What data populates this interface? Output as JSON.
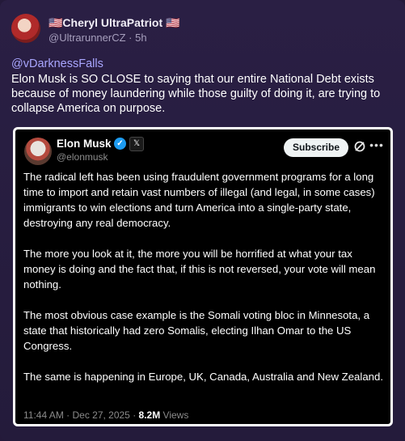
{
  "author": {
    "display_name": "🇺🇸Cheryl UltraPatriot 🇺🇸",
    "handle": "@UltrarunnerCZ",
    "separator": " · ",
    "time_ago": "5h"
  },
  "post": {
    "mention": "@vDarknessFalls",
    "text": "Elon Musk is SO CLOSE to saying that our entire National Debt exists because of money laundering while those guilty of doing it, are trying to collapse America on purpose."
  },
  "embed": {
    "author_name": "Elon Musk",
    "verified_icon": "verified-check-icon",
    "x_icon": "x-logo-icon",
    "handle": "@elonmusk",
    "subscribe_label": "Subscribe",
    "grok_icon": "grok-icon",
    "more_icon": "more-dots-icon",
    "paragraphs": [
      "The radical left has been using fraudulent government programs for a long time to import and retain vast numbers of illegal (and legal, in some cases) immigrants to win elections and turn America into a single-party state, destroying any real democracy.",
      "The more you look at it, the more you will be horrified at what your tax money is doing and the fact that, if this is not reversed, your vote will mean nothing.",
      "The most obvious case example is the Somali voting bloc in Minnesota, a state that historically had zero Somalis, electing Ilhan Omar to the US Congress.",
      "The same is happening in Europe, UK, Canada, Australia and New Zealand."
    ],
    "timestamp": "11:44 AM · Dec 27, 2025 · ",
    "views_count": "8.2M",
    "views_label": " Views"
  },
  "colors": {
    "background": "#241a3a",
    "mention": "#a9a6ff",
    "verified": "#1d9bf0"
  }
}
